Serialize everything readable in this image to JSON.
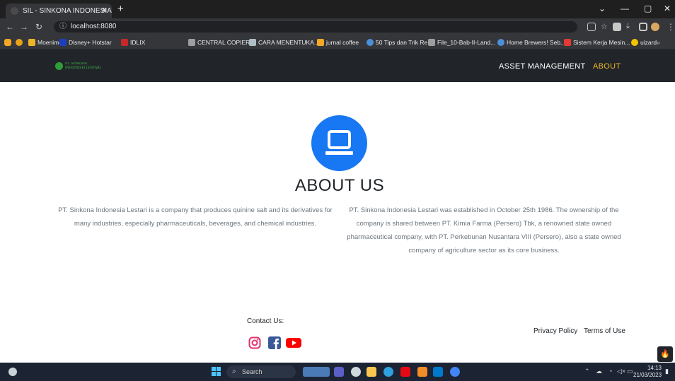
{
  "browser": {
    "tab_title": "SIL - SINKONA INDONESIA LESTA",
    "tab_close": "✕",
    "new_tab": "+",
    "window_controls": [
      "⌄",
      "—",
      "▢",
      "✕"
    ],
    "address": "localhost:8080",
    "bookmarks": [
      {
        "label": "Moenime",
        "color": "#f0b429"
      },
      {
        "label": "Disney+ Hotstar",
        "color": "#1a3fbf"
      },
      {
        "label": "IDLIX",
        "color": "#c62828"
      },
      {
        "label": "CENTRAL COPIER",
        "color": "#9e9e9e"
      },
      {
        "label": "CARA MENENTUKA...",
        "color": "#b0bec5"
      },
      {
        "label": "jurnal coffee",
        "color": "#f9a825"
      },
      {
        "label": "50 Tips dan Trik Re...",
        "color": "#4a90d9"
      },
      {
        "label": "File_10-Bab-II-Land...",
        "color": "#9e9e9e"
      },
      {
        "label": "Home Brewers! Seb...",
        "color": "#4a90d9"
      },
      {
        "label": "Sistem Kerja Mesin...",
        "color": "#e53935"
      },
      {
        "label": "uizard",
        "color": "#f5c400"
      }
    ]
  },
  "site": {
    "logo_text_line1": "PT. SINKONA",
    "logo_text_line2": "INDONESIA LESTARI",
    "nav": {
      "asset_management": "ASSET MANAGEMENT",
      "about": "ABOUT"
    },
    "about": {
      "icon": "laptop-icon",
      "title": "ABOUT US",
      "para_left": "PT. Sinkona Indonesia Lestari is a company that produces quinine salt and its derivatives for many industries, especially pharmaceuticals, beverages, and chemical industries.",
      "para_right": "PT. Sinkona Indonesia Lestari was established in October 25th 1986. The ownership of the company is shared between PT. Kimia Farma (Persero) Tbk, a renowned state owned pharmaceutical company, with PT. Perkebunan Nusantara VIII (Persero), also a state owned company of agriculture sector as its core business."
    },
    "footer": {
      "contact_label": "Contact Us:",
      "privacy": "Privacy Policy",
      "terms": "Terms of Use"
    }
  },
  "taskbar": {
    "search_placeholder": "Search",
    "time": "14:13",
    "date": "21/03/2023"
  },
  "colors": {
    "nav_bg": "#212529",
    "accent_yellow": "#f0b429",
    "icon_blue": "#1877f2"
  }
}
